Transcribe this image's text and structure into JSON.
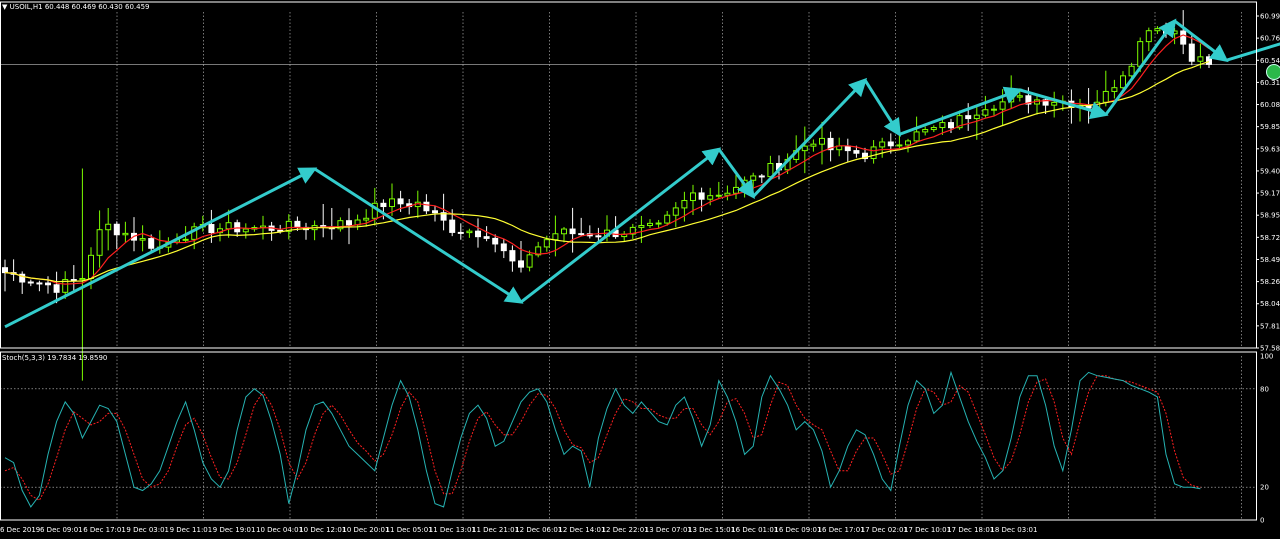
{
  "header": {
    "symbol_title": "USOIL,H1  60.448 60.469 60.430 60.459",
    "collapse_marker": "▼"
  },
  "indicator": {
    "title": "Stoch(5,3,3) 19.7834 19.8590"
  },
  "colors": {
    "background": "#000000",
    "bull_candle": "#7CFC00",
    "bear_candle": "#ffffff",
    "ma_fast": "#ff2020",
    "ma_slow": "#ffff33",
    "arrows": "#33cccc",
    "stoch_main": "#26b3b3",
    "stoch_signal": "#ff2020",
    "grid": "#c8c8c8",
    "price_line": "#a0a0a0"
  },
  "chart_data": [
    {
      "type": "candlestick",
      "symbol": "USOIL",
      "timeframe": "H1",
      "ylim": [
        57.585,
        60.99
      ],
      "price_ticks": [
        "60.990",
        "60.765",
        "60.540",
        "60.310",
        "60.085",
        "59.855",
        "59.630",
        "59.405",
        "59.175",
        "58.950",
        "58.720",
        "58.495",
        "58.265",
        "58.040",
        "57.815",
        "57.585"
      ],
      "current_price": 60.459,
      "time_labels": [
        "6 Dec 2019",
        "6 Dec 09:01",
        "6 Dec 17:01",
        "9 Dec 03:01",
        "9 Dec 11:01",
        "9 Dec 19:01",
        "10 Dec 04:01",
        "10 Dec 12:01",
        "10 Dec 20:01",
        "11 Dec 05:01",
        "11 Dec 13:01",
        "11 Dec 21:01",
        "12 Dec 06:01",
        "12 Dec 14:01",
        "12 Dec 22:01",
        "13 Dec 07:01",
        "13 Dec 15:01",
        "16 Dec 01:01",
        "16 Dec 09:01",
        "16 Dec 17:01",
        "17 Dec 02:01",
        "17 Dec 10:01",
        "17 Dec 18:01",
        "18 Dec 03:01"
      ],
      "waypoints": [
        [
          0,
          58.35
        ],
        [
          6,
          58.2
        ],
        [
          9,
          58.3
        ],
        [
          10,
          58.55
        ],
        [
          11,
          58.75
        ],
        [
          12,
          58.82
        ],
        [
          18,
          58.6
        ],
        [
          20,
          58.72
        ],
        [
          24,
          58.8
        ],
        [
          30,
          58.8
        ],
        [
          36,
          58.82
        ],
        [
          40,
          58.85
        ],
        [
          44,
          59.05
        ],
        [
          48,
          59.05
        ],
        [
          52,
          58.8
        ],
        [
          56,
          58.75
        ],
        [
          60,
          58.35
        ],
        [
          61,
          58.55
        ],
        [
          64,
          58.75
        ],
        [
          70,
          58.75
        ],
        [
          76,
          58.8
        ],
        [
          80,
          59.15
        ],
        [
          83,
          59.15
        ],
        [
          87,
          59.3
        ],
        [
          90,
          59.45
        ],
        [
          94,
          59.7
        ],
        [
          96,
          59.6
        ],
        [
          100,
          59.55
        ],
        [
          104,
          59.7
        ],
        [
          110,
          59.85
        ],
        [
          114,
          60.05
        ],
        [
          118,
          60.1
        ],
        [
          122,
          60.1
        ],
        [
          126,
          60.05
        ],
        [
          128,
          60.15
        ],
        [
          131,
          60.5
        ],
        [
          133,
          60.85
        ],
        [
          136,
          60.8
        ],
        [
          138,
          60.55
        ],
        [
          140,
          60.46
        ]
      ],
      "ma_fast_lag": 2,
      "ma_slow_lag": 5,
      "pattern_arrows": [
        {
          "from": [
            0,
            57.8
          ],
          "to": [
            36,
            59.4
          ]
        },
        {
          "from": [
            36,
            59.4
          ],
          "to": [
            60,
            58.05
          ]
        },
        {
          "from": [
            60,
            58.05
          ],
          "to": [
            83,
            59.6
          ]
        },
        {
          "from": [
            83,
            59.6
          ],
          "to": [
            87,
            59.12
          ]
        },
        {
          "from": [
            87,
            59.12
          ],
          "to": [
            100,
            60.3
          ]
        },
        {
          "from": [
            100,
            60.3
          ],
          "to": [
            104,
            59.75
          ]
        },
        {
          "from": [
            104,
            59.75
          ],
          "to": [
            118,
            60.2
          ]
        },
        {
          "from": [
            118,
            60.2
          ],
          "to": [
            128,
            59.95
          ]
        },
        {
          "from": [
            128,
            59.95
          ],
          "to": [
            136,
            60.9
          ]
        },
        {
          "from": [
            136,
            60.9
          ],
          "to": [
            142,
            60.5
          ]
        },
        {
          "from": [
            142,
            60.5
          ],
          "to": [
            157,
            60.9
          ]
        }
      ]
    },
    {
      "type": "line",
      "title": "Stoch(5,3,3)",
      "ylim": [
        0,
        100
      ],
      "levels": [
        80,
        20
      ],
      "y_ticks": [
        "100",
        "80",
        "20",
        "0"
      ],
      "main": [
        38,
        35,
        18,
        8,
        15,
        40,
        60,
        72,
        65,
        50,
        60,
        70,
        68,
        60,
        40,
        20,
        18,
        22,
        30,
        45,
        60,
        72,
        55,
        35,
        25,
        20,
        30,
        55,
        75,
        80,
        76,
        60,
        40,
        10,
        30,
        55,
        70,
        72,
        65,
        55,
        45,
        40,
        35,
        30,
        50,
        70,
        85,
        75,
        55,
        30,
        10,
        8,
        30,
        50,
        65,
        70,
        62,
        45,
        48,
        60,
        72,
        78,
        80,
        72,
        55,
        40,
        45,
        42,
        20,
        50,
        68,
        80,
        70,
        65,
        72,
        66,
        60,
        58,
        70,
        75,
        62,
        45,
        58,
        85,
        75,
        60,
        40,
        45,
        75,
        88,
        80,
        70,
        55,
        60,
        55,
        42,
        20,
        30,
        45,
        55,
        52,
        40,
        25,
        18,
        45,
        70,
        85,
        80,
        65,
        70,
        90,
        75,
        60,
        48,
        38,
        25,
        30,
        50,
        75,
        88,
        88,
        70,
        45,
        30,
        55,
        85,
        90,
        88,
        87,
        86,
        85,
        82,
        80,
        78,
        75,
        40,
        22,
        20,
        20,
        19
      ],
      "signal": [
        30,
        32,
        25,
        15,
        12,
        22,
        38,
        55,
        66,
        62,
        58,
        60,
        65,
        65,
        55,
        40,
        25,
        20,
        22,
        30,
        45,
        58,
        62,
        52,
        38,
        26,
        25,
        35,
        52,
        70,
        78,
        70,
        55,
        35,
        25,
        35,
        52,
        65,
        70,
        64,
        55,
        47,
        42,
        36,
        40,
        52,
        68,
        78,
        72,
        52,
        30,
        16,
        16,
        30,
        48,
        62,
        66,
        58,
        52,
        52,
        60,
        70,
        77,
        76,
        68,
        55,
        46,
        44,
        35,
        38,
        52,
        65,
        74,
        72,
        68,
        68,
        64,
        62,
        62,
        68,
        68,
        58,
        52,
        60,
        72,
        74,
        65,
        50,
        52,
        70,
        84,
        82,
        70,
        62,
        58,
        55,
        42,
        30,
        30,
        42,
        50,
        50,
        40,
        28,
        30,
        48,
        68,
        80,
        78,
        70,
        72,
        82,
        78,
        65,
        52,
        38,
        30,
        36,
        52,
        72,
        84,
        86,
        72,
        50,
        40,
        60,
        78,
        88,
        88,
        86,
        85,
        84,
        82,
        80,
        78,
        65,
        42,
        26,
        21,
        20
      ]
    }
  ]
}
